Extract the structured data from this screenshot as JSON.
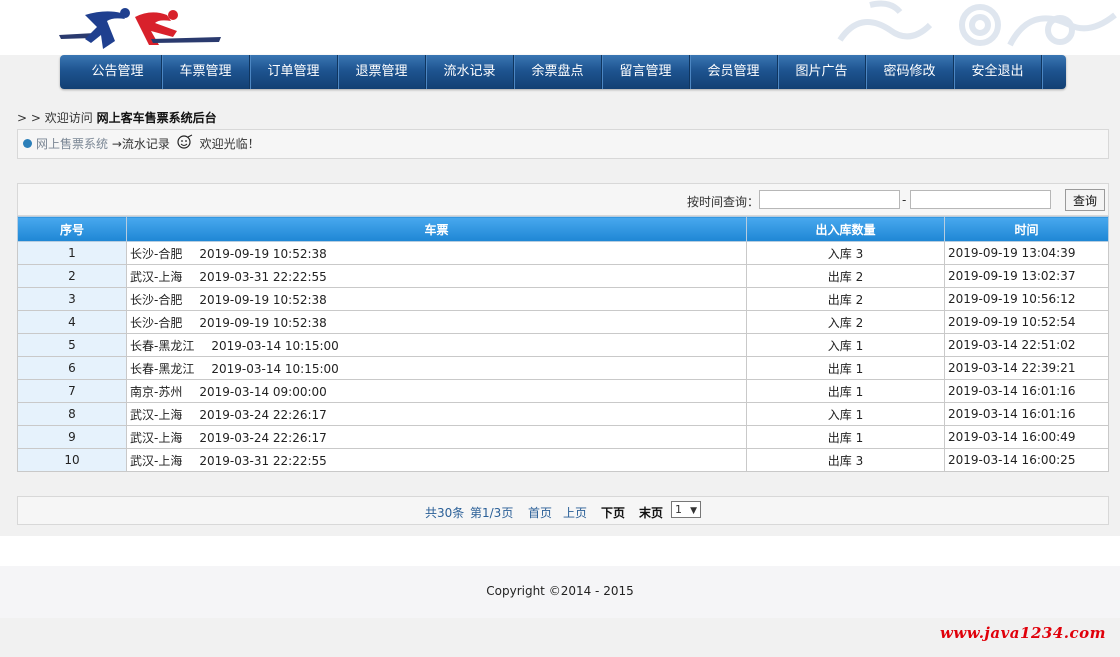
{
  "nav": {
    "items": [
      "公告管理",
      "车票管理",
      "订单管理",
      "退票管理",
      "流水记录",
      "余票盘点",
      "留言管理",
      "会员管理",
      "图片广告",
      "密码修改",
      "安全退出"
    ]
  },
  "welcome": {
    "prefix": "> >  欢迎访问 ",
    "site": "网上客车售票系统后台"
  },
  "breadcrumb": {
    "home": "网上售票系统",
    "current": "→流水记录",
    "greeting": "欢迎光临！"
  },
  "search": {
    "label": "按时间查询：",
    "separator": "-",
    "start_value": "",
    "end_value": "",
    "button": "查询"
  },
  "table": {
    "headers": [
      "序号",
      "车票",
      "出入库数量",
      "时间"
    ],
    "rows": [
      {
        "idx": "1",
        "route": "长沙-合肥",
        "departure": "2019-09-19 10:52:38",
        "qty": "入库 3",
        "time": "2019-09-19 13:04:39"
      },
      {
        "idx": "2",
        "route": "武汉-上海",
        "departure": "2019-03-31 22:22:55",
        "qty": "出库 2",
        "time": "2019-09-19 13:02:37"
      },
      {
        "idx": "3",
        "route": "长沙-合肥",
        "departure": "2019-09-19 10:52:38",
        "qty": "出库 2",
        "time": "2019-09-19 10:56:12"
      },
      {
        "idx": "4",
        "route": "长沙-合肥",
        "departure": "2019-09-19 10:52:38",
        "qty": "入库 2",
        "time": "2019-09-19 10:52:54"
      },
      {
        "idx": "5",
        "route": "长春-黑龙江",
        "departure": "2019-03-14 10:15:00",
        "qty": "入库 1",
        "time": "2019-03-14 22:51:02"
      },
      {
        "idx": "6",
        "route": "长春-黑龙江",
        "departure": "2019-03-14 10:15:00",
        "qty": "出库 1",
        "time": "2019-03-14 22:39:21"
      },
      {
        "idx": "7",
        "route": "南京-苏州",
        "departure": "2019-03-14 09:00:00",
        "qty": "出库 1",
        "time": "2019-03-14 16:01:16"
      },
      {
        "idx": "8",
        "route": "武汉-上海",
        "departure": "2019-03-24 22:26:17",
        "qty": "入库 1",
        "time": "2019-03-14 16:01:16"
      },
      {
        "idx": "9",
        "route": "武汉-上海",
        "departure": "2019-03-24 22:26:17",
        "qty": "出库 1",
        "time": "2019-03-14 16:00:49"
      },
      {
        "idx": "10",
        "route": "武汉-上海",
        "departure": "2019-03-31 22:22:55",
        "qty": "出库 3",
        "time": "2019-03-14 16:00:25"
      }
    ]
  },
  "pager": {
    "total": "共30条",
    "page": "第1/3页",
    "first": "首页",
    "prev": "上页",
    "next": "下页",
    "last": "末页",
    "select_value": "1"
  },
  "footer": {
    "copyright": "Copyright ©2014 - 2015",
    "watermark": "www.java1234.com"
  },
  "colors": {
    "nav": "#1e5490",
    "table_header": "#2f95e0",
    "watermark": "#e0000a"
  }
}
